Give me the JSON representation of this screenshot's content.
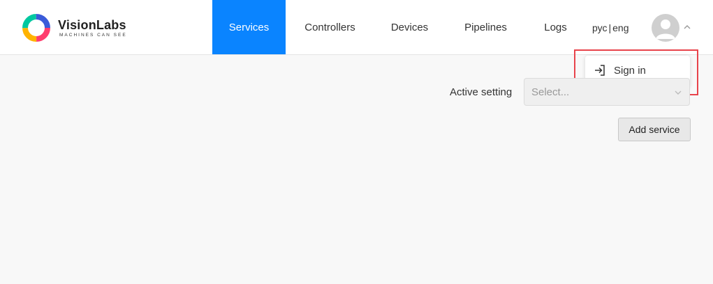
{
  "brand": {
    "name": "VisionLabs",
    "tagline": "MACHINES CAN SEE"
  },
  "nav": {
    "tabs": [
      {
        "label": "Services",
        "active": true
      },
      {
        "label": "Controllers",
        "active": false
      },
      {
        "label": "Devices",
        "active": false
      },
      {
        "label": "Pipelines",
        "active": false
      },
      {
        "label": "Logs",
        "active": false
      }
    ],
    "active_color": "#0a84ff"
  },
  "language": {
    "ru": "рус",
    "separator": "|",
    "en": "eng"
  },
  "user_menu": {
    "items": [
      {
        "label": "Sign in",
        "icon": "sign-in-icon"
      }
    ],
    "highlight_color": "#e8434b"
  },
  "settings": {
    "label": "Active setting",
    "select_placeholder": "Select..."
  },
  "actions": {
    "add_service": "Add service"
  }
}
